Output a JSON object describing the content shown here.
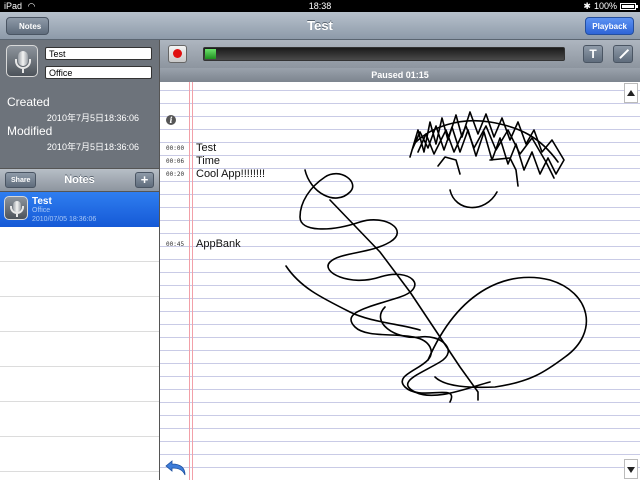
{
  "status_bar": {
    "device": "iPad",
    "time": "18:38",
    "battery": "100%",
    "battery_level": 1.0
  },
  "nav": {
    "back_label": "Notes",
    "title": "Test",
    "playback_label": "Playback"
  },
  "note_info": {
    "title": "Test",
    "subtitle": "Office",
    "created_label": "Created",
    "created_value": "2010年7月5日18:36:06",
    "modified_label": "Modified",
    "modified_value": "2010年7月5日18:36:06"
  },
  "list_toolbar": {
    "share_label": "Share",
    "title": "Notes",
    "add_label": "+"
  },
  "notes": [
    {
      "title": "Test",
      "subtitle": "Office",
      "date": "2010/07/05 18:36:06",
      "selected": true
    }
  ],
  "recorder": {
    "progress": 0.03,
    "status": "Paused 01:15",
    "text_tool": "T"
  },
  "paper": {
    "entries": [
      {
        "time": "00:00",
        "text": "Test"
      },
      {
        "time": "00:06",
        "text": "Time"
      },
      {
        "time": "00:20",
        "text": "Cool App!!!!!!!!"
      },
      {
        "time": "00:45",
        "text": "AppBank"
      }
    ]
  },
  "colors": {
    "accent_blue": "#2f7ef0",
    "record_red": "#e01010",
    "progress_green": "#2fa52f",
    "margin_red": "#f2a0a8",
    "ruled_line": "#c9cbe6"
  },
  "icons": [
    "wifi-icon",
    "bluetooth-icon",
    "battery-icon",
    "back-arrow-icon",
    "microphone-icon",
    "record-icon",
    "text-tool-icon",
    "pen-tool-icon",
    "info-icon",
    "scroll-up-icon",
    "scroll-down-icon",
    "undo-icon"
  ]
}
